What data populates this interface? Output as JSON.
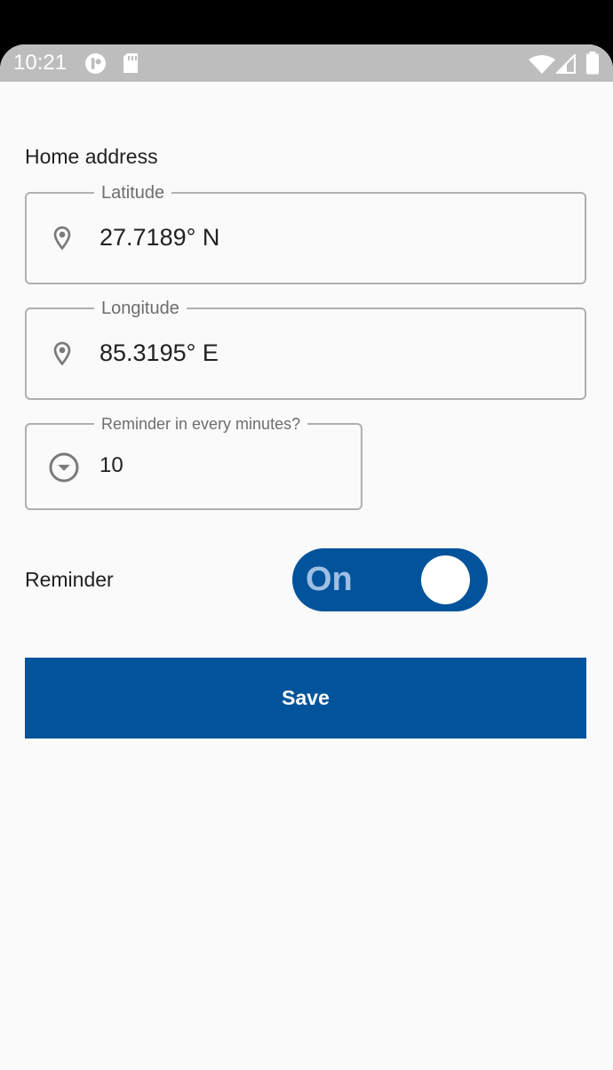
{
  "status_bar": {
    "time": "10:21",
    "icons": [
      "app-notification-icon",
      "sd-card-icon",
      "wifi-icon",
      "cell-signal-icon",
      "battery-icon"
    ]
  },
  "form": {
    "section_title": "Home address",
    "latitude": {
      "label": "Latitude",
      "value": "27.7189° N",
      "icon": "location-pin-icon"
    },
    "longitude": {
      "label": "Longitude",
      "value": "85.3195° E",
      "icon": "location-pin-icon"
    },
    "reminder_interval": {
      "label": "Reminder in every minutes?",
      "value": "10",
      "icon": "dropdown-circle-icon"
    },
    "reminder": {
      "label": "Reminder",
      "toggle_text": "On",
      "enabled": true
    },
    "save_label": "Save"
  },
  "colors": {
    "primary": "#01539B",
    "toggle_text": "#9EBFE3",
    "status_bar": "#BDBDBD",
    "background": "#FAFAFA",
    "border": "#B0B0B0"
  }
}
